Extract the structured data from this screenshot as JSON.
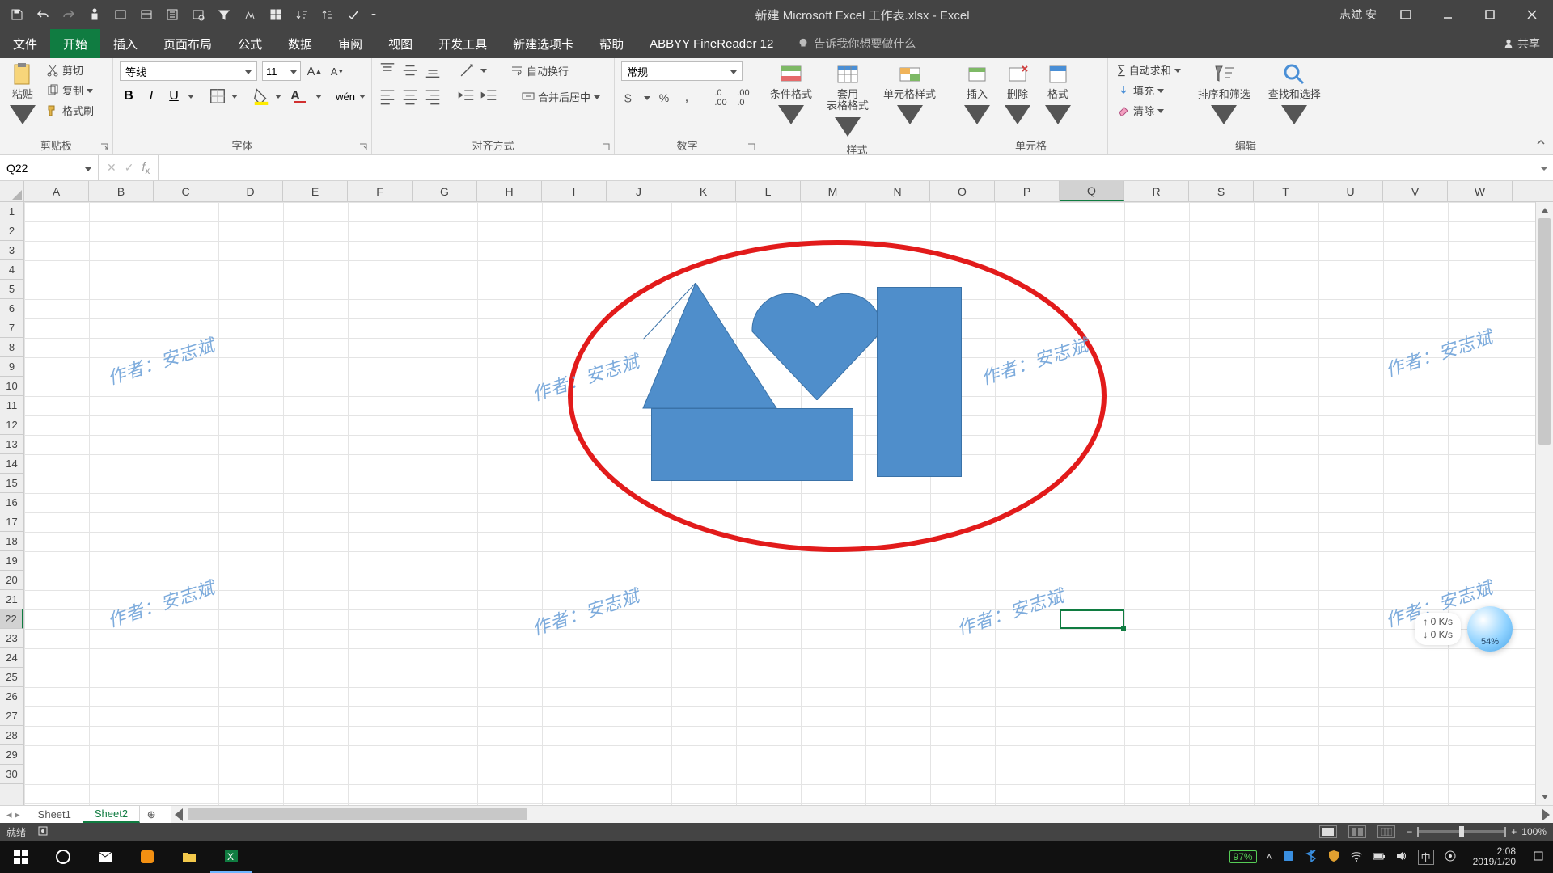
{
  "title": "新建 Microsoft Excel 工作表.xlsx  -  Excel",
  "user": "志斌 安",
  "tabs": [
    "文件",
    "开始",
    "插入",
    "页面布局",
    "公式",
    "数据",
    "审阅",
    "视图",
    "开发工具",
    "新建选项卡",
    "帮助",
    "ABBYY FineReader 12"
  ],
  "active_tab_index": 1,
  "tell_me": "告诉我你想要做什么",
  "share": "共享",
  "ribbon": {
    "clipboard": {
      "paste": "粘贴",
      "cut": "剪切",
      "copy": "复制",
      "format_painter": "格式刷",
      "label": "剪贴板"
    },
    "font": {
      "name": "等线",
      "size": "11",
      "label": "字体"
    },
    "alignment": {
      "wrap": "自动换行",
      "merge": "合并后居中",
      "label": "对齐方式"
    },
    "number": {
      "format": "常规",
      "label": "数字"
    },
    "styles": {
      "cond": "条件格式",
      "table": "套用\n表格格式",
      "cell": "单元格样式",
      "label": "样式"
    },
    "cells": {
      "insert": "插入",
      "delete": "删除",
      "format": "格式",
      "label": "单元格"
    },
    "editing": {
      "autosum": "自动求和",
      "fill": "填充",
      "clear": "清除",
      "sort": "排序和筛选",
      "find": "查找和选择",
      "label": "编辑"
    }
  },
  "namebox": "Q22",
  "columns": [
    "A",
    "B",
    "C",
    "D",
    "E",
    "F",
    "G",
    "H",
    "I",
    "J",
    "K",
    "L",
    "M",
    "N",
    "O",
    "P",
    "Q",
    "R",
    "S",
    "T",
    "U",
    "V",
    "W"
  ],
  "selected_col": "Q",
  "rows": [
    1,
    2,
    3,
    4,
    5,
    6,
    7,
    8,
    9,
    10,
    11,
    12,
    13,
    14,
    15,
    16,
    17,
    18,
    19,
    20,
    21,
    22,
    23,
    24,
    25,
    26,
    27,
    28,
    29,
    30
  ],
  "selected_row": 22,
  "sheets": [
    "Sheet1",
    "Sheet2"
  ],
  "active_sheet_index": 1,
  "status": {
    "ready": "就绪"
  },
  "zoom": "100%",
  "watermark": "作者：安志斌",
  "float": {
    "up": "↑ 0  K/s",
    "down": "↓ 0  K/s",
    "pct": "54%"
  },
  "taskbar": {
    "battery": "97%",
    "time": "2:08",
    "date": "2019/1/20",
    "ime": "中"
  }
}
